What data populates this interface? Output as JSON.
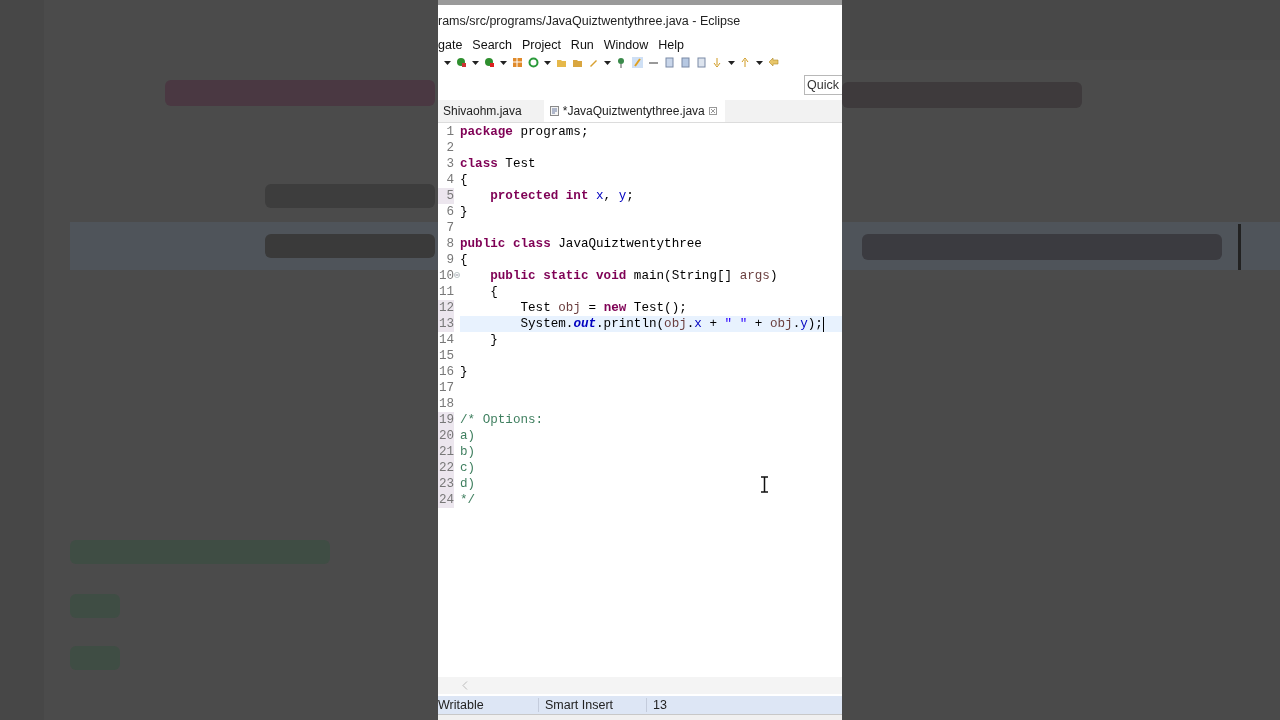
{
  "window": {
    "title": "rams/src/programs/JavaQuiztwentythree.java - Eclipse"
  },
  "menu": [
    "gate",
    "Search",
    "Project",
    "Run",
    "Window",
    "Help"
  ],
  "quick_access": {
    "placeholder": "Quick"
  },
  "tabs": [
    {
      "label": "Shivaohm.java",
      "selected": false,
      "closable": false
    },
    {
      "label": "*JavaQuiztwentythree.java",
      "selected": true,
      "closable": true
    }
  ],
  "editor": {
    "lines": [
      {
        "number": "1",
        "marked": false,
        "current": false,
        "foldable": false,
        "tokens": [
          {
            "text": "package",
            "kind": "keyword"
          },
          {
            "text": " programs;",
            "kind": "plain"
          }
        ]
      },
      {
        "number": "2",
        "marked": false,
        "current": false,
        "foldable": false
      },
      {
        "number": "3",
        "marked": false,
        "current": false,
        "foldable": false,
        "tokens": [
          {
            "text": "class",
            "kind": "keyword"
          },
          {
            "text": " Test",
            "kind": "plain"
          }
        ]
      },
      {
        "number": "4",
        "marked": false,
        "current": false,
        "foldable": false,
        "tokens": [
          {
            "text": "{",
            "kind": "plain"
          }
        ]
      },
      {
        "number": "5",
        "marked": true,
        "current": false,
        "foldable": false,
        "tokens": [
          {
            "text": "    protected",
            "kind": "keyword"
          },
          {
            "text": " int",
            "kind": "keyword"
          },
          {
            "text": " x",
            "kind": "field"
          },
          {
            "text": ", ",
            "kind": "plain"
          },
          {
            "text": "y",
            "kind": "field"
          },
          {
            "text": ";",
            "kind": "plain"
          }
        ]
      },
      {
        "number": "6",
        "marked": false,
        "current": false,
        "foldable": false,
        "tokens": [
          {
            "text": "}",
            "kind": "plain"
          }
        ]
      },
      {
        "number": "7",
        "marked": false,
        "current": false,
        "foldable": false
      },
      {
        "number": "8",
        "marked": false,
        "current": false,
        "foldable": false,
        "tokens": [
          {
            "text": "public",
            "kind": "keyword"
          },
          {
            "text": " class",
            "kind": "keyword"
          },
          {
            "text": " JavaQuiztwentythree",
            "kind": "plain"
          }
        ]
      },
      {
        "number": "9",
        "marked": false,
        "current": false,
        "foldable": false,
        "tokens": [
          {
            "text": "{",
            "kind": "plain"
          }
        ]
      },
      {
        "number": "10",
        "marked": false,
        "current": false,
        "foldable": true,
        "tokens": [
          {
            "text": "    public",
            "kind": "keyword"
          },
          {
            "text": " static",
            "kind": "keyword"
          },
          {
            "text": " void",
            "kind": "keyword"
          },
          {
            "text": " main(String[] ",
            "kind": "plain"
          },
          {
            "text": "args",
            "kind": "variable"
          },
          {
            "text": ")",
            "kind": "plain"
          }
        ]
      },
      {
        "number": "11",
        "marked": false,
        "current": false,
        "foldable": false,
        "tokens": [
          {
            "text": "    {",
            "kind": "plain"
          }
        ]
      },
      {
        "number": "12",
        "marked": true,
        "current": false,
        "foldable": false,
        "tokens": [
          {
            "text": "        Test ",
            "kind": "plain"
          },
          {
            "text": "obj",
            "kind": "variable"
          },
          {
            "text": " = ",
            "kind": "plain"
          },
          {
            "text": "new",
            "kind": "keyword"
          },
          {
            "text": " Test();",
            "kind": "plain"
          }
        ]
      },
      {
        "number": "13",
        "marked": true,
        "current": true,
        "foldable": false,
        "tokens": [
          {
            "text": "        System.",
            "kind": "plain"
          },
          {
            "text": "out",
            "kind": "static_field"
          },
          {
            "text": ".println(",
            "kind": "plain"
          },
          {
            "text": "obj",
            "kind": "variable"
          },
          {
            "text": ".",
            "kind": "plain"
          },
          {
            "text": "x",
            "kind": "field"
          },
          {
            "text": " + ",
            "kind": "plain"
          },
          {
            "text": "\" \"",
            "kind": "string"
          },
          {
            "text": " + ",
            "kind": "plain"
          },
          {
            "text": "obj",
            "kind": "variable"
          },
          {
            "text": ".",
            "kind": "plain"
          },
          {
            "text": "y",
            "kind": "field"
          },
          {
            "text": ");",
            "kind": "plain"
          }
        ]
      },
      {
        "number": "14",
        "marked": false,
        "current": false,
        "foldable": false,
        "tokens": [
          {
            "text": "    }",
            "kind": "plain"
          }
        ]
      },
      {
        "number": "15",
        "marked": false,
        "current": false,
        "foldable": false
      },
      {
        "number": "16",
        "marked": false,
        "current": false,
        "foldable": false,
        "tokens": [
          {
            "text": "}",
            "kind": "plain"
          }
        ]
      },
      {
        "number": "17",
        "marked": false,
        "current": false,
        "foldable": false
      },
      {
        "number": "18",
        "marked": false,
        "current": false,
        "foldable": false
      },
      {
        "number": "19",
        "marked": true,
        "current": false,
        "foldable": false,
        "tokens": [
          {
            "text": "/* Options:",
            "kind": "comment"
          }
        ]
      },
      {
        "number": "20",
        "marked": true,
        "current": false,
        "foldable": false,
        "tokens": [
          {
            "text": "a)",
            "kind": "comment"
          }
        ]
      },
      {
        "number": "21",
        "marked": true,
        "current": false,
        "foldable": false,
        "tokens": [
          {
            "text": "b)",
            "kind": "comment"
          }
        ]
      },
      {
        "number": "22",
        "marked": true,
        "current": false,
        "foldable": false,
        "tokens": [
          {
            "text": "c)",
            "kind": "comment"
          }
        ]
      },
      {
        "number": "23",
        "marked": true,
        "current": false,
        "foldable": false,
        "tokens": [
          {
            "text": "d)",
            "kind": "comment"
          }
        ]
      },
      {
        "number": "24",
        "marked": true,
        "current": false,
        "foldable": false,
        "tokens": [
          {
            "text": "*/",
            "kind": "comment"
          }
        ]
      }
    ]
  },
  "status_bar": [
    "Writable",
    "Smart Insert",
    "13"
  ]
}
